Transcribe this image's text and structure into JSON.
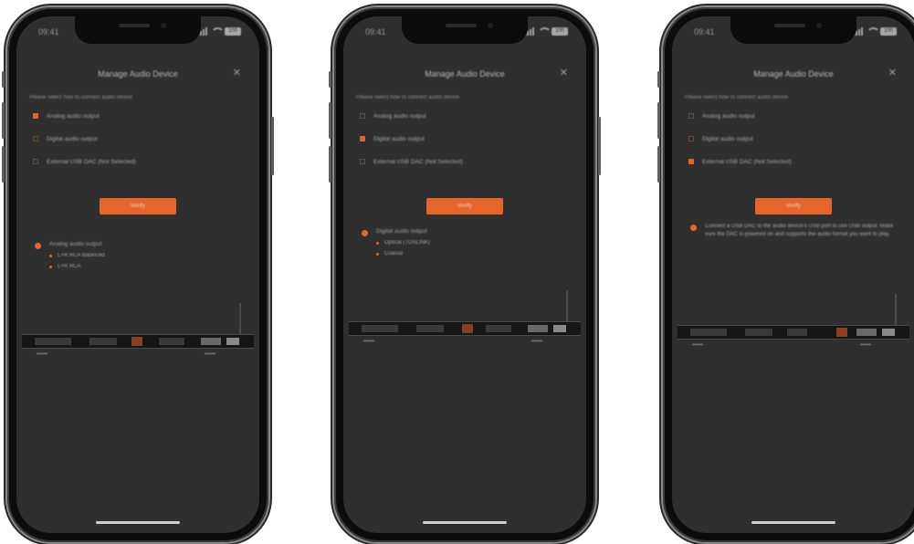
{
  "colors": {
    "accent": "#e5652b",
    "screen_bg": "#2f2f2f",
    "frame": "#0c0c0c"
  },
  "screens": [
    {
      "status": {
        "time": "09:41",
        "battery": "100"
      },
      "title": "Manage Audio Device",
      "close_icon": "close-icon",
      "intro": "Please select how to connect audio device",
      "options": [
        {
          "label": "Analog audio output",
          "selected": true
        },
        {
          "label": "Digital audio output",
          "selected": false
        },
        {
          "label": "External USB DAC (Not Selected)",
          "selected": false
        }
      ],
      "button": "Verify",
      "result": {
        "heading": "Analog audio output",
        "items": [
          "L+R RCA Balanced",
          "L+R RCA"
        ]
      }
    },
    {
      "status": {
        "time": "09:41",
        "battery": "100"
      },
      "title": "Manage Audio Device",
      "close_icon": "close-icon",
      "intro": "Please select how to connect audio device",
      "options": [
        {
          "label": "Analog audio output",
          "selected": false
        },
        {
          "label": "Digital audio output",
          "selected": true
        },
        {
          "label": "External USB DAC (Not Selected)",
          "selected": false
        }
      ],
      "button": "Verify",
      "result": {
        "heading": "Digital audio output",
        "items": [
          "Optical (TOSLINK)",
          "Coaxial"
        ]
      }
    },
    {
      "status": {
        "time": "09:41",
        "battery": "100"
      },
      "title": "Manage Audio Device",
      "close_icon": "close-icon",
      "intro": "Please select how to connect audio device",
      "options": [
        {
          "label": "Analog audio output",
          "selected": false
        },
        {
          "label": "Digital audio output",
          "selected": false
        },
        {
          "label": "External USB DAC (Not Selected)",
          "selected": true
        }
      ],
      "button": "Verify",
      "result": {
        "paragraph": "Connect a USB DAC to the audio device's USB port to use USB output. Make sure the DAC is powered on and supports the audio format you want to play."
      }
    }
  ]
}
